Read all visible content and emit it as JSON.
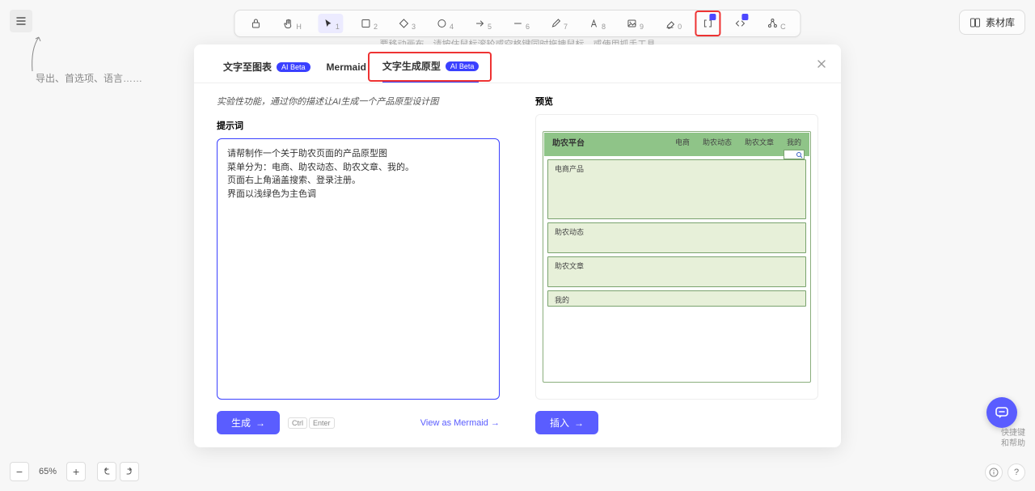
{
  "menu_tooltip": "导出、首选项、语言……",
  "canvas_hint": "要移动画布，请按住鼠标滚轮或空格键同时拖拽鼠标，或使用抓手工具",
  "toolbar": {
    "items": [
      {
        "name": "lock-icon",
        "sub": ""
      },
      {
        "name": "hand-icon",
        "sub": "H"
      },
      {
        "name": "pointer-icon",
        "sub": "1",
        "selected": true
      },
      {
        "name": "square-icon",
        "sub": "2"
      },
      {
        "name": "diamond-icon",
        "sub": "3"
      },
      {
        "name": "circle-icon",
        "sub": "4"
      },
      {
        "name": "arrow-icon",
        "sub": "5"
      },
      {
        "name": "line-icon",
        "sub": "6"
      },
      {
        "name": "pencil-icon",
        "sub": "7"
      },
      {
        "name": "text-icon",
        "sub": "8"
      },
      {
        "name": "image-icon",
        "sub": "9"
      },
      {
        "name": "eraser-icon",
        "sub": "0"
      },
      {
        "name": "ai-brackets-icon",
        "sub": "",
        "highlight": true,
        "ai": true
      },
      {
        "name": "code-icon",
        "sub": "",
        "ai": true
      },
      {
        "name": "graph-icon",
        "sub": "C"
      }
    ]
  },
  "material_button": "素材库",
  "modal": {
    "tabs": [
      {
        "label": "文字至图表",
        "badge": "AI Beta"
      },
      {
        "label": "Mermaid"
      },
      {
        "label": "文字生成原型",
        "badge": "AI Beta",
        "active": true,
        "highlight": true
      }
    ],
    "description": "实验性功能，通过你的描述让AI生成一个产品原型设计图",
    "prompt_label": "提示词",
    "prompt_value": "请帮制作一个关于助农页面的产品原型图\n菜单分为：电商、助农动态、助农文章、我的。\n页面右上角涵盖搜索、登录注册。\n界面以浅绿色为主色调",
    "generate_label": "生成",
    "kbd1": "Ctrl",
    "kbd2": "Enter",
    "view_mermaid": "View as Mermaid",
    "preview_label": "预览",
    "insert_label": "插入",
    "mock": {
      "title": "助农平台",
      "nav": [
        "电商",
        "助农动态",
        "助农文章",
        "我的"
      ],
      "sections": [
        "电商产品",
        "助农动态",
        "助农文章",
        "我的"
      ]
    }
  },
  "help_label": "快捷键\n和帮助",
  "zoom": {
    "minus": "−",
    "plus": "+",
    "value": "65%"
  }
}
